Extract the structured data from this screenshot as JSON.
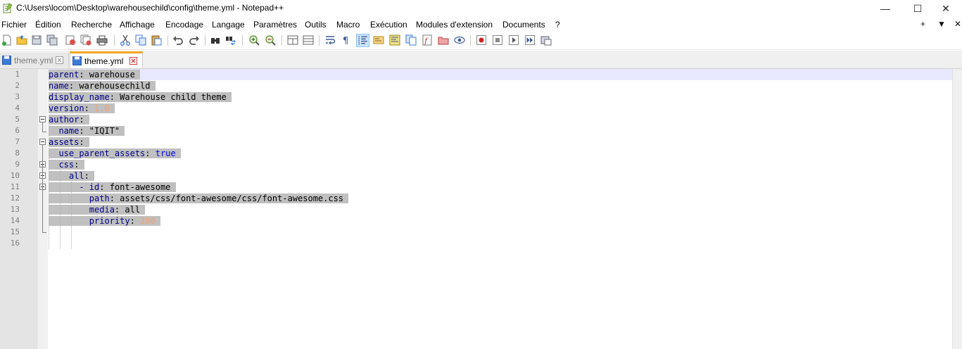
{
  "window": {
    "title": "C:\\Users\\locom\\Desktop\\warehousechild\\config\\theme.yml - Notepad++",
    "minimize_glyph": "—",
    "maximize_glyph": "☐",
    "close_glyph": "✕"
  },
  "menu": {
    "items": [
      "Fichier",
      "Édition",
      "Recherche",
      "Affichage",
      "Encodage",
      "Langage",
      "Paramètres",
      "Outils",
      "Macro",
      "Exécution",
      "Modules d'extension",
      "Documents",
      "?"
    ],
    "right": [
      "+",
      "▼",
      "✕"
    ]
  },
  "toolbar": {
    "icons": [
      "new-file-icon",
      "open-file-icon",
      "save-icon",
      "save-all-icon",
      "close-icon",
      "close-all-icon",
      "print-icon",
      "cut-icon",
      "copy-icon",
      "paste-icon",
      "undo-icon",
      "redo-icon",
      "find-icon",
      "replace-icon",
      "zoom-in-icon",
      "zoom-out-icon",
      "sync-vertical-icon",
      "sync-horizontal-icon",
      "word-wrap-icon",
      "show-all-chars-icon",
      "indent-guide-icon",
      "udl-icon",
      "doc-map-icon",
      "doc-list-icon",
      "function-list-icon",
      "folder-workspace-icon",
      "monitoring-icon",
      "record-macro-icon",
      "stop-macro-icon",
      "play-macro-icon",
      "run-macro-multiple-icon",
      "save-macro-icon"
    ],
    "active_icon": "indent-guide-icon"
  },
  "tabs": [
    {
      "label": "theme.yml",
      "active": false
    },
    {
      "label": "theme.yml",
      "active": true
    }
  ],
  "editor": {
    "line_numbers": [
      "1",
      "2",
      "3",
      "4",
      "5",
      "6",
      "7",
      "8",
      "9",
      "10",
      "11",
      "12",
      "13",
      "14",
      "15",
      "16"
    ],
    "lines": [
      [
        {
          "t": "parent",
          "c": "k"
        },
        {
          "t": ": warehouse",
          "c": "v"
        },
        {
          "t": " ",
          "c": "v"
        }
      ],
      [
        {
          "t": "name",
          "c": "k"
        },
        {
          "t": ": warehousechild",
          "c": "v"
        },
        {
          "t": " ",
          "c": "v"
        }
      ],
      [
        {
          "t": "display_name",
          "c": "k"
        },
        {
          "t": ": Warehouse child theme",
          "c": "v"
        },
        {
          "t": " ",
          "c": "v"
        }
      ],
      [
        {
          "t": "version",
          "c": "k"
        },
        {
          "t": ": ",
          "c": "v"
        },
        {
          "t": "1.0",
          "c": "n"
        },
        {
          "t": " ",
          "c": "v"
        }
      ],
      [
        {
          "t": "author",
          "c": "k"
        },
        {
          "t": ":",
          "c": "v"
        },
        {
          "t": " ",
          "c": "v"
        }
      ],
      [
        {
          "t": "  name",
          "c": "k"
        },
        {
          "t": ": \"IQIT\"",
          "c": "v"
        },
        {
          "t": " ",
          "c": "v"
        }
      ],
      [
        {
          "t": "assets",
          "c": "k"
        },
        {
          "t": ":",
          "c": "v"
        },
        {
          "t": " ",
          "c": "v"
        }
      ],
      [
        {
          "t": "  use_parent_assets",
          "c": "k"
        },
        {
          "t": ": ",
          "c": "v"
        },
        {
          "t": "true",
          "c": "b"
        },
        {
          "t": " ",
          "c": "v"
        }
      ],
      [
        {
          "t": "  css",
          "c": "k"
        },
        {
          "t": ":",
          "c": "v"
        },
        {
          "t": " ",
          "c": "v"
        }
      ],
      [
        {
          "t": "    all",
          "c": "k"
        },
        {
          "t": ":",
          "c": "v"
        },
        {
          "t": " ",
          "c": "v"
        }
      ],
      [
        {
          "t": "      - ",
          "c": "k"
        },
        {
          "t": "id",
          "c": "k"
        },
        {
          "t": ": font-awesome",
          "c": "v"
        },
        {
          "t": " ",
          "c": "v"
        }
      ],
      [
        {
          "t": "        path",
          "c": "k"
        },
        {
          "t": ": assets/css/font-awesome/css/font-awesome.css",
          "c": "v"
        },
        {
          "t": " ",
          "c": "v"
        }
      ],
      [
        {
          "t": "        media",
          "c": "k"
        },
        {
          "t": ": all",
          "c": "v"
        },
        {
          "t": " ",
          "c": "v"
        }
      ],
      [
        {
          "t": "        priority",
          "c": "k"
        },
        {
          "t": ": ",
          "c": "v"
        },
        {
          "t": "200",
          "c": "n"
        },
        {
          "t": " ",
          "c": "v"
        }
      ],
      [],
      []
    ]
  }
}
